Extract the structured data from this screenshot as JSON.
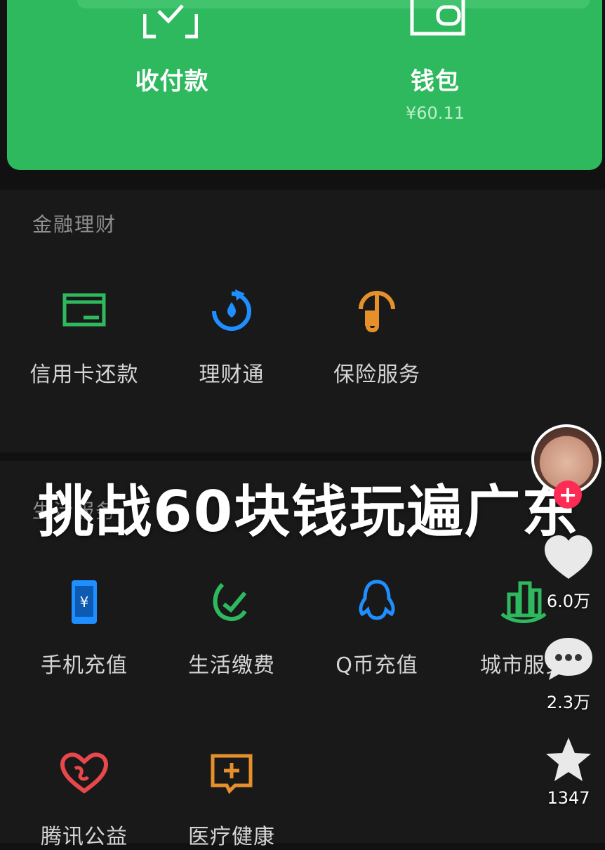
{
  "wallet_card": {
    "pay_label": "收付款",
    "wallet_label": "钱包",
    "wallet_balance": "¥60.11"
  },
  "finance": {
    "title": "金融理财",
    "items": [
      {
        "label": "信用卡还款",
        "icon": "credit-card-icon"
      },
      {
        "label": "理财通",
        "icon": "wealth-drop-icon"
      },
      {
        "label": "保险服务",
        "icon": "insurance-umbrella-icon"
      }
    ]
  },
  "life": {
    "title": "生活服务",
    "row1": [
      {
        "label": "手机充值",
        "icon": "phone-topup-icon"
      },
      {
        "label": "生活缴费",
        "icon": "utility-bill-icon"
      },
      {
        "label": "Q币充值",
        "icon": "qq-penguin-icon"
      },
      {
        "label": "城市服务",
        "icon": "city-buildings-icon"
      }
    ],
    "row2": [
      {
        "label": "腾讯公益",
        "icon": "charity-heart-icon"
      },
      {
        "label": "医疗健康",
        "icon": "medical-cross-icon"
      }
    ]
  },
  "overlay": {
    "title": "挑战60块钱玩遍广东"
  },
  "side_actions": {
    "like_count": "6.0万",
    "comment_count": "2.3万",
    "favorite_count": "1347"
  },
  "colors": {
    "wallet_green": "#2fb95f",
    "accent_green": "#2fb95f",
    "blue": "#1f8fff",
    "orange": "#e6902c",
    "red": "#e8474c",
    "follow_red": "#fe2c55"
  }
}
